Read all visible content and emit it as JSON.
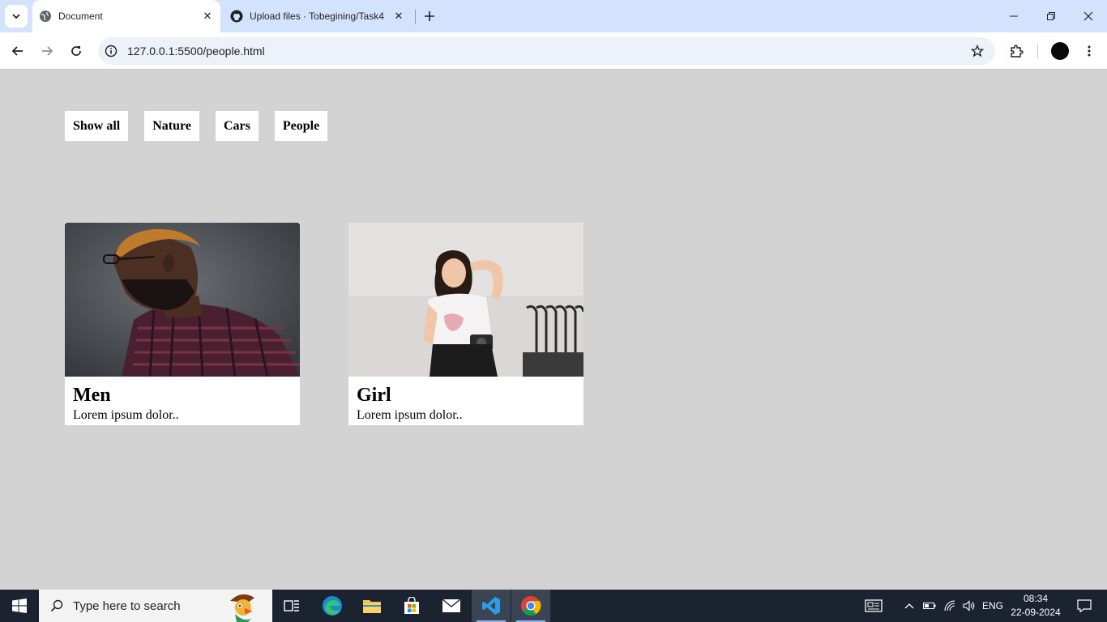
{
  "browser": {
    "tabs": [
      {
        "title": "Document",
        "active": true
      },
      {
        "title": "Upload files · Tobegining/Task4",
        "active": false
      }
    ],
    "url": "127.0.0.1:5500/people.html",
    "accent": "#d3e3fd"
  },
  "page": {
    "background": "#d3d3d3",
    "filters": [
      "Show all",
      "Nature",
      "Cars",
      "People"
    ],
    "cards": [
      {
        "title": "Men",
        "text": "Lorem ipsum dolor.."
      },
      {
        "title": "Girl",
        "text": "Lorem ipsum dolor.."
      }
    ]
  },
  "taskbar": {
    "search_placeholder": "Type here to search",
    "language": "ENG",
    "time": "08:34",
    "date": "22-09-2024"
  }
}
